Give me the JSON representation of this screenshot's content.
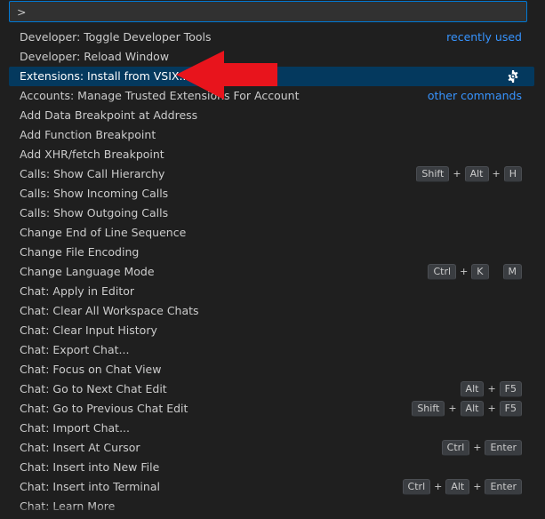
{
  "input": {
    "value": ">"
  },
  "items": [
    {
      "label": "Developer: Toggle Developer Tools",
      "hint": "recently used",
      "keys": []
    },
    {
      "label": "Developer: Reload Window",
      "hint": "",
      "keys": []
    },
    {
      "label": "Extensions: Install from VSIX...",
      "hint": "",
      "keys": [],
      "selected": true,
      "gear": "gear-icon"
    },
    {
      "label": "Accounts: Manage Trusted Extensions For Account",
      "hint": "other commands",
      "keys": []
    },
    {
      "label": "Add Data Breakpoint at Address",
      "hint": "",
      "keys": []
    },
    {
      "label": "Add Function Breakpoint",
      "hint": "",
      "keys": []
    },
    {
      "label": "Add XHR/fetch Breakpoint",
      "hint": "",
      "keys": []
    },
    {
      "label": "Calls: Show Call Hierarchy",
      "hint": "",
      "keys": [
        [
          "Shift",
          "Alt",
          "H"
        ]
      ]
    },
    {
      "label": "Calls: Show Incoming Calls",
      "hint": "",
      "keys": []
    },
    {
      "label": "Calls: Show Outgoing Calls",
      "hint": "",
      "keys": []
    },
    {
      "label": "Change End of Line Sequence",
      "hint": "",
      "keys": []
    },
    {
      "label": "Change File Encoding",
      "hint": "",
      "keys": []
    },
    {
      "label": "Change Language Mode",
      "hint": "",
      "keys": [
        [
          "Ctrl",
          "K"
        ],
        [
          "M"
        ]
      ]
    },
    {
      "label": "Chat: Apply in Editor",
      "hint": "",
      "keys": []
    },
    {
      "label": "Chat: Clear All Workspace Chats",
      "hint": "",
      "keys": []
    },
    {
      "label": "Chat: Clear Input History",
      "hint": "",
      "keys": []
    },
    {
      "label": "Chat: Export Chat...",
      "hint": "",
      "keys": []
    },
    {
      "label": "Chat: Focus on Chat View",
      "hint": "",
      "keys": []
    },
    {
      "label": "Chat: Go to Next Chat Edit",
      "hint": "",
      "keys": [
        [
          "Alt",
          "F5"
        ]
      ]
    },
    {
      "label": "Chat: Go to Previous Chat Edit",
      "hint": "",
      "keys": [
        [
          "Shift",
          "Alt",
          "F5"
        ]
      ]
    },
    {
      "label": "Chat: Import Chat...",
      "hint": "",
      "keys": []
    },
    {
      "label": "Chat: Insert At Cursor",
      "hint": "",
      "keys": [
        [
          "Ctrl",
          "Enter"
        ]
      ]
    },
    {
      "label": "Chat: Insert into New File",
      "hint": "",
      "keys": []
    },
    {
      "label": "Chat: Insert into Terminal",
      "hint": "",
      "keys": [
        [
          "Ctrl",
          "Alt",
          "Enter"
        ]
      ]
    },
    {
      "label": "Chat: Learn More",
      "hint": "",
      "keys": []
    }
  ],
  "colors": {
    "background": "#1f1f1f",
    "selection": "#04395e",
    "focus_border": "#0078d4",
    "link": "#3794ff",
    "annotation_arrow": "#e8141c"
  }
}
